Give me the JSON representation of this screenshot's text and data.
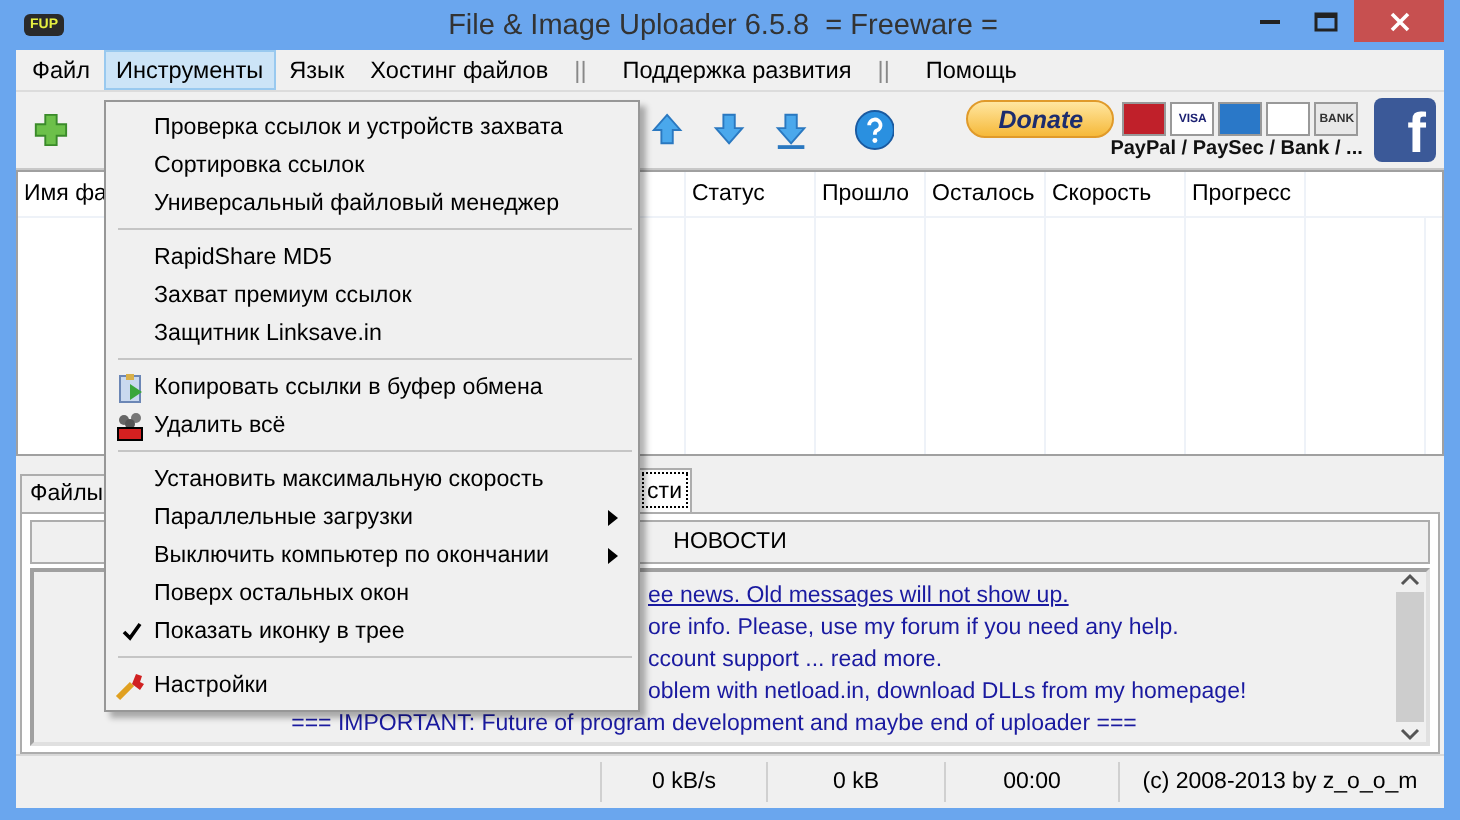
{
  "window": {
    "logo": "FUP",
    "title": "File & Image Uploader 6.5.8  = Freeware ="
  },
  "menubar": [
    {
      "kind": "item",
      "label": "Файл",
      "selected": false
    },
    {
      "kind": "item",
      "label": "Инструменты",
      "selected": true
    },
    {
      "kind": "item",
      "label": "Язык",
      "selected": false
    },
    {
      "kind": "item",
      "label": "Хостинг файлов",
      "selected": false
    },
    {
      "kind": "bar",
      "label": "||",
      "selected": false
    },
    {
      "kind": "item",
      "label": "Поддержка развития",
      "selected": false
    },
    {
      "kind": "bar",
      "label": "||",
      "selected": false
    },
    {
      "kind": "item",
      "label": "Помощь",
      "selected": false
    }
  ],
  "toolbar": {
    "donate": "Donate",
    "payment_methods": "PayPal / PaySec / Bank / ...",
    "cards": [
      {
        "kind": "mastercard"
      },
      {
        "kind": "visa",
        "label": "VISA"
      },
      {
        "kind": "amex"
      },
      {
        "kind": "discover"
      },
      {
        "kind": "bank",
        "label": "BANK"
      }
    ],
    "facebook": "f"
  },
  "table": {
    "columns": [
      "Имя фа",
      "Статус",
      "Прошло",
      "Осталось",
      "Скорость",
      "Прогресс"
    ]
  },
  "tabs": [
    {
      "label": "Файлы",
      "selected": false
    },
    {
      "label": "сти",
      "selected": true
    }
  ],
  "news": {
    "header": "НОВОСТИ",
    "lines": [
      {
        "kind": "link",
        "text": "ee news. Old messages will not show up."
      },
      {
        "kind": "text",
        "text": "ore info. Please, use my forum if you need any help."
      },
      {
        "kind": "text",
        "text": "ccount support ... read more."
      },
      {
        "kind": "text",
        "text": "oblem with netload.in, download DLLs from my homepage!"
      },
      {
        "kind": "centered",
        "text": "=== IMPORTANT: Future of program development and maybe end of uploader ==="
      }
    ]
  },
  "status_bar": [
    "0 kB/s",
    "0 kB",
    "00:00",
    "(c) 2008-2013 by z_o_o_m"
  ],
  "dropdown": [
    {
      "kind": "item",
      "label": "Проверка ссылок и устройств захвата",
      "checked": false,
      "submenu": false
    },
    {
      "kind": "item",
      "label": "Сортировка ссылок",
      "checked": false,
      "submenu": false
    },
    {
      "kind": "item",
      "label": "Универсальный файловый менеджер",
      "checked": false,
      "submenu": false
    },
    {
      "kind": "separator"
    },
    {
      "kind": "item",
      "label": "RapidShare MD5",
      "checked": false,
      "submenu": false
    },
    {
      "kind": "item",
      "label": "Захват премиум ссылок",
      "checked": false,
      "submenu": false
    },
    {
      "kind": "item",
      "label": "Защитник Linksave.in",
      "checked": false,
      "submenu": false
    },
    {
      "kind": "separator"
    },
    {
      "kind": "copy",
      "label": "Копировать ссылки в буфер обмена",
      "checked": false,
      "submenu": false
    },
    {
      "kind": "clear",
      "label": "Удалить всё",
      "checked": false,
      "submenu": false
    },
    {
      "kind": "separator"
    },
    {
      "kind": "item",
      "label": "Установить максимальную скорость",
      "checked": false,
      "submenu": false
    },
    {
      "kind": "item",
      "label": "Параллельные загрузки",
      "checked": false,
      "submenu": true
    },
    {
      "kind": "item",
      "label": "Выключить компьютер по окончании",
      "checked": false,
      "submenu": true
    },
    {
      "kind": "item",
      "label": "Поверх остальных окон",
      "checked": false,
      "submenu": false
    },
    {
      "kind": "item",
      "label": "Показать иконку в трее",
      "checked": true,
      "submenu": false
    },
    {
      "kind": "separator"
    },
    {
      "kind": "settings",
      "label": "Настройки",
      "checked": false,
      "submenu": false
    }
  ]
}
